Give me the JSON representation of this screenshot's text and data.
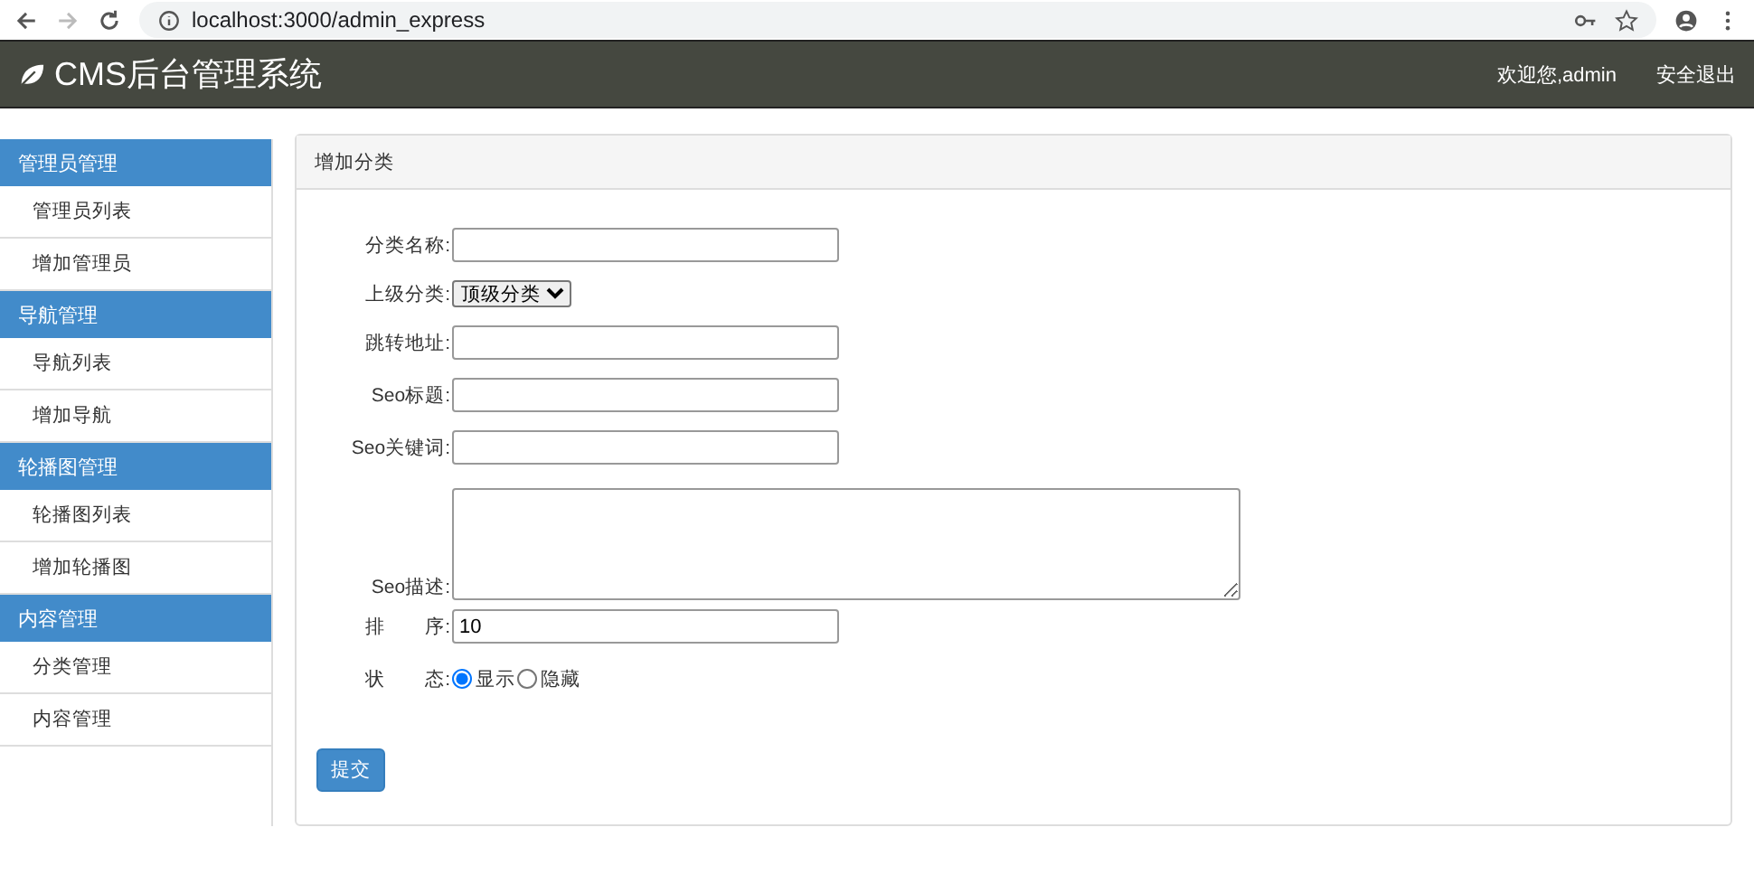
{
  "browser": {
    "url": "localhost:3000/admin_express"
  },
  "header": {
    "title": "CMS后台管理系统",
    "welcome": "欢迎您,admin",
    "logout": "安全退出"
  },
  "sidebar": [
    {
      "title": "管理员管理",
      "items": [
        {
          "label": "管理员列表"
        },
        {
          "label": "增加管理员"
        }
      ]
    },
    {
      "title": "导航管理",
      "items": [
        {
          "label": "导航列表"
        },
        {
          "label": "增加导航"
        }
      ]
    },
    {
      "title": "轮播图管理",
      "items": [
        {
          "label": "轮播图列表"
        },
        {
          "label": "增加轮播图"
        }
      ]
    },
    {
      "title": "内容管理",
      "items": [
        {
          "label": "分类管理"
        },
        {
          "label": "内容管理"
        }
      ]
    }
  ],
  "panel": {
    "title": "增加分类"
  },
  "form": [
    {
      "kind": "text",
      "label": "分类名称:"
    },
    {
      "kind": "select",
      "label": "上级分类:",
      "value": "顶级分类"
    },
    {
      "kind": "text",
      "label": "跳转地址:"
    },
    {
      "kind": "text",
      "label": "Seo标题:"
    },
    {
      "kind": "text",
      "label": "Seo关键词:"
    },
    {
      "kind": "textarea",
      "label": "Seo描述:"
    },
    {
      "kind": "text",
      "label": "排　　序:",
      "value": "10"
    },
    {
      "kind": "radio",
      "label": "状　　态:",
      "options": [
        {
          "label": "显示",
          "selected": true
        },
        {
          "label": "隐藏",
          "selected": false
        }
      ]
    }
  ],
  "submit": "提交"
}
